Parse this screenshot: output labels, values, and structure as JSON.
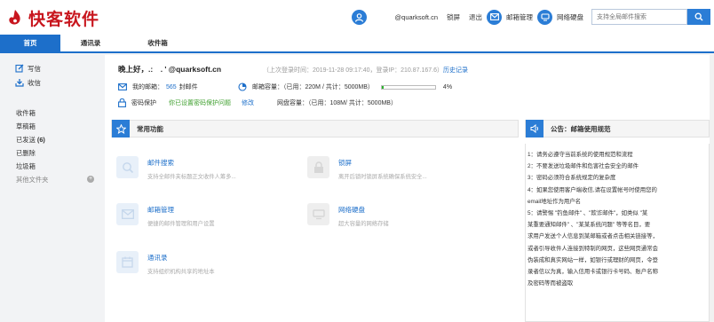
{
  "header": {
    "logo_text": "快客软件",
    "user_email": "@quarksoft.cn",
    "lock_label": "锁屏",
    "logout_label": "退出",
    "mail_admin_label": "邮箱管理",
    "netdisk_label": "网络硬盘",
    "search_placeholder": "支持全局邮件搜索"
  },
  "tabs": [
    "首页",
    "通讯录",
    "收件箱"
  ],
  "sidebar": {
    "compose": "写信",
    "receive": "收信",
    "folders": [
      "收件箱",
      "草稿箱",
      "已发送",
      "已删除",
      "垃圾箱"
    ],
    "sent_count": "(6)",
    "other": "其他文件夹",
    "add": "+"
  },
  "greeting": "晚上好，.:　. ' @quarksoft.cn",
  "last_login": {
    "text": "（上次登录时间：2019-11-28 09:17:40，登录IP：210.87.167.6）",
    "link": "历史记录"
  },
  "mailbox": {
    "label": "我的邮箱：",
    "count": "565",
    "unit": "封邮件"
  },
  "capacity": {
    "label": "邮箱容量：（已用：220M / 共计：5000MB）",
    "percent": "4%",
    "fill": 0.04
  },
  "password": {
    "label": "密码保护",
    "status": "你已设置密码保护问题",
    "modify": "修改"
  },
  "disk": {
    "label": "网盘容量：（已用：108M/ 共计：5000MB）"
  },
  "functions": {
    "title": "常用功能",
    "items": [
      {
        "title": "邮件搜索",
        "desc": "支持全邮件夹标题正文收件人筹多..."
      },
      {
        "title": "锁屏",
        "desc": "离开后锁时锁屏系统确保系统安全..."
      },
      {
        "title": "邮箱管理",
        "desc": "便捷的邮件管理和用户设置"
      },
      {
        "title": "网络硬盘",
        "desc": "超大容量的网络存储"
      },
      {
        "title": "通讯录",
        "desc": "支持组织机构共享的地址本"
      }
    ]
  },
  "notice": {
    "title": "公告：邮箱使用规范",
    "lines": [
      "1：请务必遵守当前系统的使用规范和流程",
      "2：不要发送垃圾邮件和危害社会安全的邮件",
      "3：密码必须符合系统规定的复杂度",
      "4：如果您使用客户端收信,请在设置帐号时使用您的",
      "email地址作为用户名",
      "5：请警惕 \"钓鱼邮件\" 、\"欺诈邮件\"，如类似 \"某",
      "某重要通知邮件\" 、\"某某系统问题\" 等等名目，要",
      "求用户发送个人信息到某邮箱或者点击相关链接等，",
      "或者引导收件人连接到特制的网页，这些网页通常会",
      "伪装成和真实网站一样，如银行或理财的网页，令登",
      "录者信以为真，输入信用卡或银行卡号码、账户名称",
      "及密码等而被盗取"
    ]
  },
  "colors": {
    "brand_red": "#c8161e",
    "accent_blue": "#1d6fca",
    "green": "#3e9f2d"
  }
}
